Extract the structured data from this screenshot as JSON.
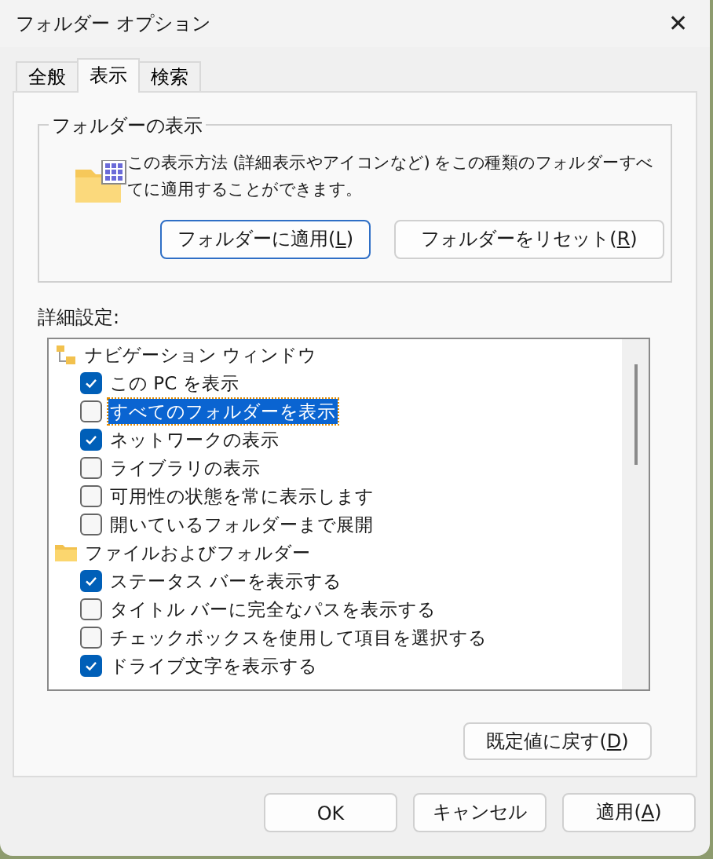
{
  "window": {
    "title": "フォルダー オプション",
    "close": "✕"
  },
  "tabs": [
    {
      "label": "全般",
      "selected": false
    },
    {
      "label": "表示",
      "selected": true
    },
    {
      "label": "検索",
      "selected": false
    }
  ],
  "folder_view": {
    "title": "フォルダーの表示",
    "description": "この表示方法 (詳細表示やアイコンなど) をこの種類のフォルダーすべてに適用することができます。",
    "buttons": [
      {
        "label": "フォルダーに適用(**L**)",
        "default": true
      },
      {
        "label": "フォルダーをリセット(**R**)",
        "default": false
      }
    ]
  },
  "advanced": {
    "label": "詳細設定:",
    "items": [
      {
        "kind": "tree",
        "label": "ナビゲーション ウィンドウ",
        "children": [
          {
            "kind": "checkbox",
            "label": "この PC を表示",
            "checked": true,
            "selected": false
          },
          {
            "kind": "checkbox",
            "label": "すべてのフォルダーを表示",
            "checked": false,
            "selected": true
          },
          {
            "kind": "checkbox",
            "label": "ネットワークの表示",
            "checked": true,
            "selected": false
          },
          {
            "kind": "checkbox",
            "label": "ライブラリの表示",
            "checked": false,
            "selected": false
          },
          {
            "kind": "checkbox",
            "label": "可用性の状態を常に表示します",
            "checked": false,
            "selected": false
          },
          {
            "kind": "checkbox",
            "label": "開いているフォルダーまで展開",
            "checked": false,
            "selected": false
          }
        ]
      },
      {
        "kind": "folder",
        "label": "ファイルおよびフォルダー",
        "children": [
          {
            "kind": "checkbox",
            "label": "ステータス バーを表示する",
            "checked": true,
            "selected": false
          },
          {
            "kind": "checkbox",
            "label": "タイトル バーに完全なパスを表示する",
            "checked": false,
            "selected": false
          },
          {
            "kind": "checkbox",
            "label": "チェックボックスを使用して項目を選択する",
            "checked": false,
            "selected": false
          },
          {
            "kind": "checkbox",
            "label": "ドライブ文字を表示する",
            "checked": true,
            "selected": false
          }
        ]
      }
    ],
    "restore": "既定値に戻す(**D**)"
  },
  "buttons": [
    {
      "label": "OK"
    },
    {
      "label": "キャンセル"
    },
    {
      "label": "適用(**A**)"
    }
  ]
}
